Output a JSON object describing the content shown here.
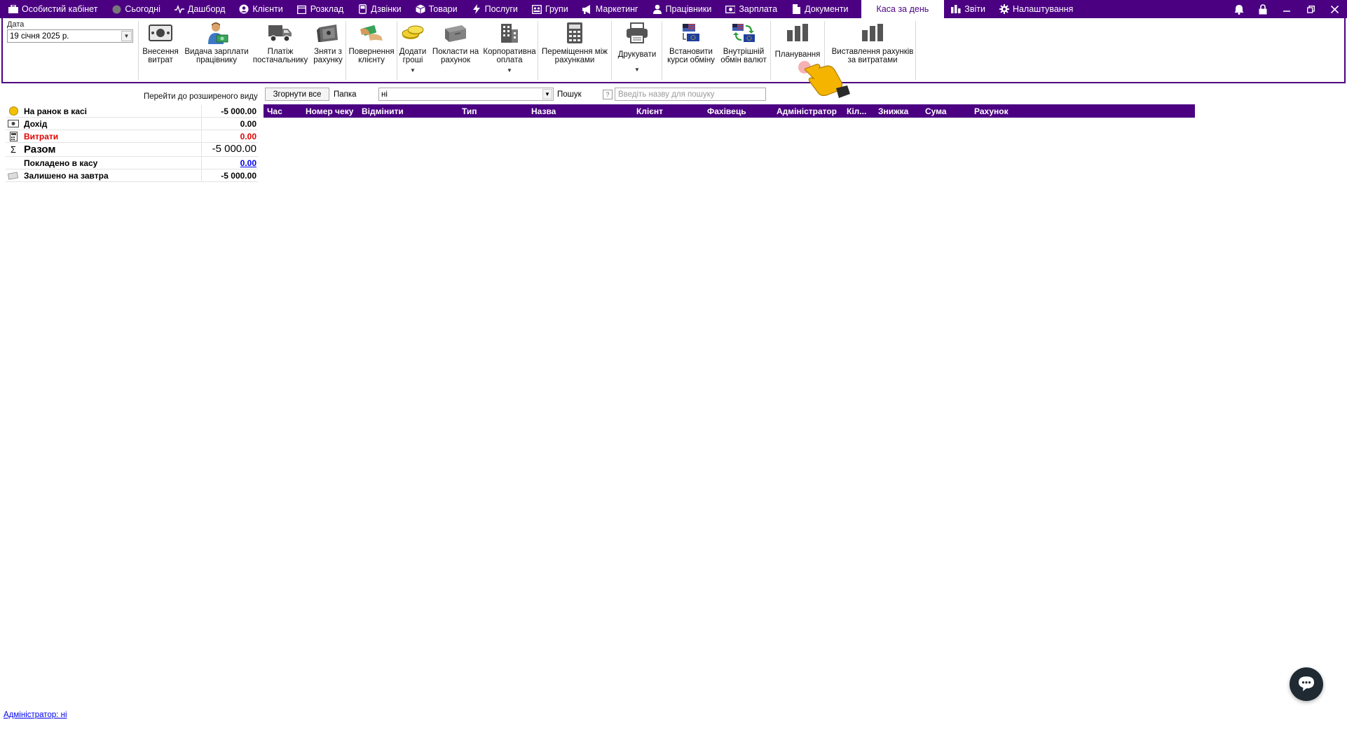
{
  "menu": {
    "items": [
      {
        "label": "Особистий кабінет",
        "icon": "cabinet-icon"
      },
      {
        "label": "Сьогодні",
        "icon": "today-icon"
      },
      {
        "label": "Дашборд",
        "icon": "pulse-icon"
      },
      {
        "label": "Клієнти",
        "icon": "client-icon"
      },
      {
        "label": "Розклад",
        "icon": "calendar-icon"
      },
      {
        "label": "Дзвінки",
        "icon": "phone-icon"
      },
      {
        "label": "Товари",
        "icon": "box-icon"
      },
      {
        "label": "Послуги",
        "icon": "lightning-icon"
      },
      {
        "label": "Групи",
        "icon": "groups-icon"
      },
      {
        "label": "Маркетинг",
        "icon": "megaphone-icon"
      },
      {
        "label": "Працівники",
        "icon": "user-icon"
      },
      {
        "label": "Зарплата",
        "icon": "money-icon"
      },
      {
        "label": "Документи",
        "icon": "document-icon"
      }
    ],
    "active": "Каса за день",
    "after": [
      {
        "label": "Звіти",
        "icon": "bar-chart-icon"
      },
      {
        "label": "Налаштування",
        "icon": "gear-icon"
      }
    ]
  },
  "ribbon": {
    "date_label": "Дата",
    "date_value": "19 січня 2025 р.",
    "buttons": [
      {
        "line1": "Внесення",
        "line2": "витрат",
        "icon": "cash-note-icon"
      },
      {
        "line1": "Видача зарплати",
        "line2": "працівнику",
        "icon": "employee-money-icon"
      },
      {
        "line1": "Платіж",
        "line2": "постачальнику",
        "icon": "truck-icon"
      },
      {
        "line1": "Зняти з",
        "line2": "рахунку",
        "icon": "safe-icon"
      },
      {
        "line1": "Повернення",
        "line2": "клієнту",
        "icon": "refund-icon"
      },
      {
        "line1": "Додати",
        "line2": "гроші",
        "icon": "coins-icon"
      },
      {
        "line1": "Покласти на",
        "line2": "рахунок",
        "icon": "deposit-box-icon"
      },
      {
        "line1": "Корпоративна",
        "line2": "оплата",
        "icon": "building-icon"
      },
      {
        "line1": "Переміщення між",
        "line2": "рахунками",
        "icon": "calculator-icon"
      },
      {
        "line1": "Друкувати",
        "line2": "",
        "icon": "printer-icon"
      },
      {
        "line1": "Встановити",
        "line2": "курси обміну",
        "icon": "exchange-rate-icon"
      },
      {
        "line1": "Внутрішній",
        "line2": "обмін валют",
        "icon": "currency-exchange-icon"
      },
      {
        "line1": "Планування",
        "line2": "",
        "icon": "planning-chart-icon"
      },
      {
        "line1": "Виставлення рахунків",
        "line2": "за витратами",
        "icon": "invoice-chart-icon"
      }
    ]
  },
  "summary": {
    "expand_link": "Перейти до розширеного виду",
    "rows": [
      {
        "label": "На ранок в касі",
        "value": "-5 000.00"
      },
      {
        "label": "Дохід",
        "value": "0.00"
      },
      {
        "label": "Витрати",
        "value": "0.00"
      },
      {
        "label": "Разом",
        "value": "-5 000.00"
      },
      {
        "label": "Покладено в касу",
        "value": "0.00"
      },
      {
        "label": "Залишено на завтра",
        "value": "-5 000.00"
      }
    ]
  },
  "filter": {
    "collapse_label": "Згорнути все",
    "folder_label": "Папка",
    "folder_value": "ні",
    "search_label": "Пошук",
    "help": "?",
    "search_placeholder": "Введіть назву для пошуку"
  },
  "grid": {
    "columns": [
      "Час",
      "Номер чеку",
      "Відмінити",
      "Тип",
      "Назва",
      "Клієнт",
      "Фахівець",
      "Адміністратор",
      "Кіл...",
      "Знижка",
      "Сума",
      "Рахунок"
    ]
  },
  "footer": {
    "admin_link": "Адміністратор: ні"
  },
  "colors": {
    "accent": "#4b0082",
    "negative": "#e00000"
  }
}
